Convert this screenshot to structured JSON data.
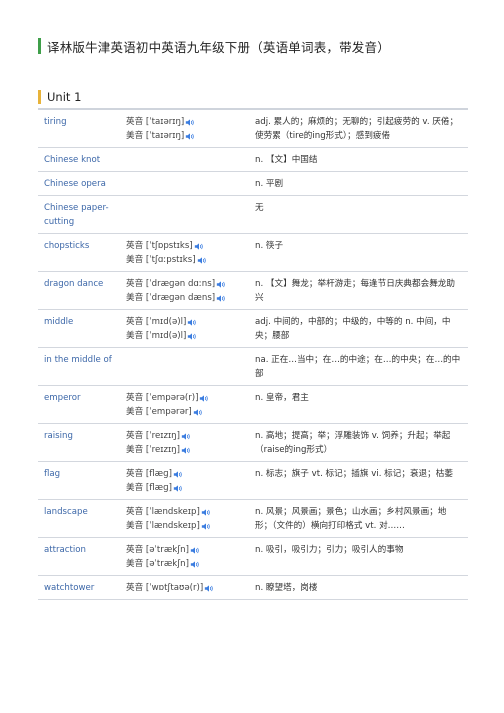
{
  "header": {
    "title": "译林版牛津英语初中英语九年级下册（英语单词表，带发音）",
    "accent_color": "#3f9f4a"
  },
  "unit": {
    "label": "Unit 1",
    "accent_color": "#e8b33a"
  },
  "icons": {
    "audio": "speaker-icon",
    "audio_color": "#3b7de0"
  },
  "entries": [
    {
      "word": "tiring",
      "uk": "英音 [ˈtaɪərɪŋ]",
      "us": "美音 [ˈtaɪərɪŋ]",
      "meaning": "adj. 累人的；麻烦的；无聊的；引起疲劳的 v. 厌倦；使劳累（tire的ing形式）；感到疲倦"
    },
    {
      "word": "Chinese knot",
      "uk": "",
      "us": "",
      "meaning": "n. 【文】中国结"
    },
    {
      "word": "Chinese opera",
      "uk": "",
      "us": "",
      "meaning": "n. 平剧"
    },
    {
      "word": "Chinese paper-cutting",
      "uk": "",
      "us": "",
      "meaning": "无"
    },
    {
      "word": "chopsticks",
      "uk": "英音 [ˈtʃɒpstɪks]",
      "us": "美音 [ˈtʃɑːpstɪks]",
      "meaning": "n. 筷子"
    },
    {
      "word": "dragon dance",
      "uk": "英音 [ˈdræɡən dɑːns]",
      "us": "美音 [ˈdræɡən dæns]",
      "meaning": "n. 【文】舞龙；举杆游走；每逢节日庆典都会舞龙助兴"
    },
    {
      "word": "middle",
      "uk": "英音 [ˈmɪd(ə)l]",
      "us": "美音 [ˈmɪd(ə)l]",
      "meaning": "adj. 中间的，中部的；中级的，中等的 n. 中间，中央；腰部"
    },
    {
      "word": "in the middle of",
      "uk": "",
      "us": "",
      "meaning": "na. 正在…当中；在…的中途；在…的中央；在…的中部"
    },
    {
      "word": "emperor",
      "uk": "英音 [ˈempərə(r)]",
      "us": "美音 [ˈempərər]",
      "meaning": "n. 皇帝，君主"
    },
    {
      "word": "raising",
      "uk": "英音 [ˈreɪzɪŋ]",
      "us": "美音 [ˈreɪzɪŋ]",
      "meaning": "n. 高地；提高；举；浮雕装饰 v. 饲养；升起；举起（raise的ing形式）"
    },
    {
      "word": "flag",
      "uk": "英音 [flæɡ]",
      "us": "美音 [flæɡ]",
      "meaning": "n. 标志；旗子 vt. 标记；插旗 vi. 标记；衰退；枯萎"
    },
    {
      "word": "landscape",
      "uk": "英音 [ˈlændskeɪp]",
      "us": "美音 [ˈlændskeɪp]",
      "meaning": "n. 风景；风景画；景色；山水画；乡村风景画；地形；（文件的）横向打印格式 vt. 对……"
    },
    {
      "word": "attraction",
      "uk": "英音 [əˈtrækʃn]",
      "us": "美音 [əˈtrækʃn]",
      "meaning": "n. 吸引，吸引力；引力；吸引人的事物"
    },
    {
      "word": "watchtower",
      "uk": "英音 [ˈwɒtʃtaʊə(r)]",
      "us": "",
      "meaning": "n. 瞭望塔，岗楼"
    }
  ]
}
